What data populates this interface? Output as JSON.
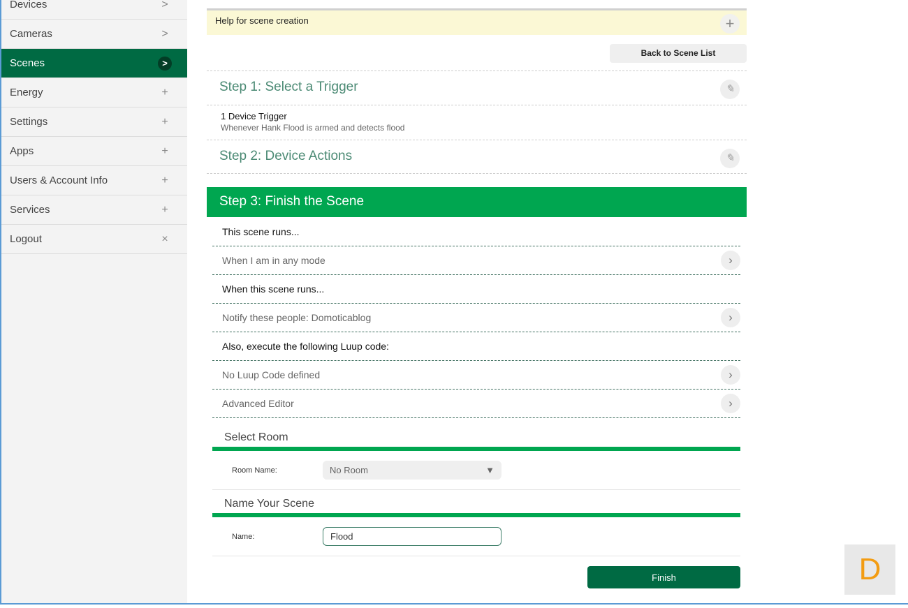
{
  "sidebar": {
    "items": [
      {
        "label": "Devices",
        "icon": ">"
      },
      {
        "label": "Cameras",
        "icon": ">"
      },
      {
        "label": "Scenes",
        "icon": ">",
        "active": true
      },
      {
        "label": "Energy",
        "icon": "+"
      },
      {
        "label": "Settings",
        "icon": "+"
      },
      {
        "label": "Apps",
        "icon": "+"
      },
      {
        "label": "Users & Account Info",
        "icon": "+"
      },
      {
        "label": "Services",
        "icon": "+"
      },
      {
        "label": "Logout",
        "icon": "×"
      }
    ]
  },
  "help": {
    "label": "Help for scene creation",
    "icon": "+"
  },
  "back_label": "Back to Scene List",
  "step1": {
    "title": "Step 1: Select a Trigger",
    "trigger_title": "1 Device Trigger",
    "trigger_desc": "Whenever Hank Flood is armed and detects flood"
  },
  "step2": {
    "title": "Step 2: Device Actions"
  },
  "step3": {
    "title": "Step 3: Finish the Scene",
    "rows": [
      {
        "text": "This scene runs...",
        "type": "header"
      },
      {
        "text": "When I am in any mode",
        "type": "link"
      },
      {
        "text": "When this scene runs...",
        "type": "header"
      },
      {
        "text": "Notify these people: Domoticablog",
        "type": "link"
      },
      {
        "text": "Also, execute the following Luup code:",
        "type": "header"
      },
      {
        "text": "No Luup Code defined",
        "type": "link"
      },
      {
        "text": "Advanced Editor",
        "type": "link"
      }
    ]
  },
  "room": {
    "title": "Select Room",
    "label": "Room Name:",
    "value": "No Room"
  },
  "name": {
    "title": "Name Your Scene",
    "label": "Name:",
    "value": "Flood"
  },
  "finish_label": "Finish",
  "badge": "D",
  "colors": {
    "accent": "#00a650",
    "dark": "#006a43"
  }
}
